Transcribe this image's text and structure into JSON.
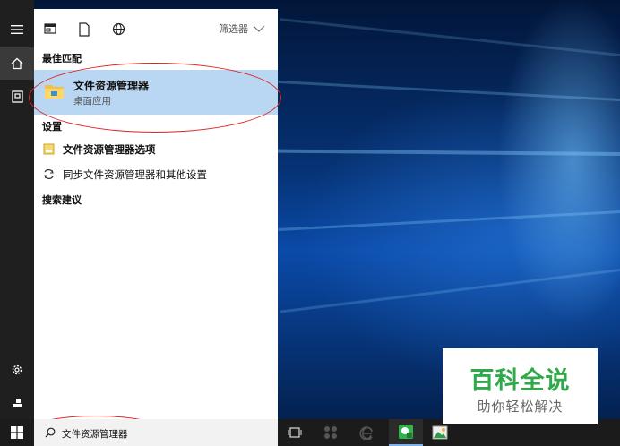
{
  "panel": {
    "filter_label": "筛选器",
    "best_match": {
      "heading": "最佳匹配",
      "title": "文件资源管理器",
      "subtitle": "桌面应用"
    },
    "settings": {
      "heading": "设置",
      "items": [
        {
          "label": "文件资源管理器选项",
          "icon": "folder-options-icon"
        },
        {
          "label": "同步文件资源管理器和其他设置",
          "icon": "sync-icon"
        }
      ]
    },
    "suggestions_heading": "搜索建议"
  },
  "taskbar": {
    "search_value": "文件资源管理器"
  },
  "watermark": {
    "title": "百科全说",
    "tagline": "助你轻松解决"
  },
  "colors": {
    "highlight": "#b9d7f2",
    "annotation": "#e02020",
    "watermark_green": "#2eaa4b"
  }
}
